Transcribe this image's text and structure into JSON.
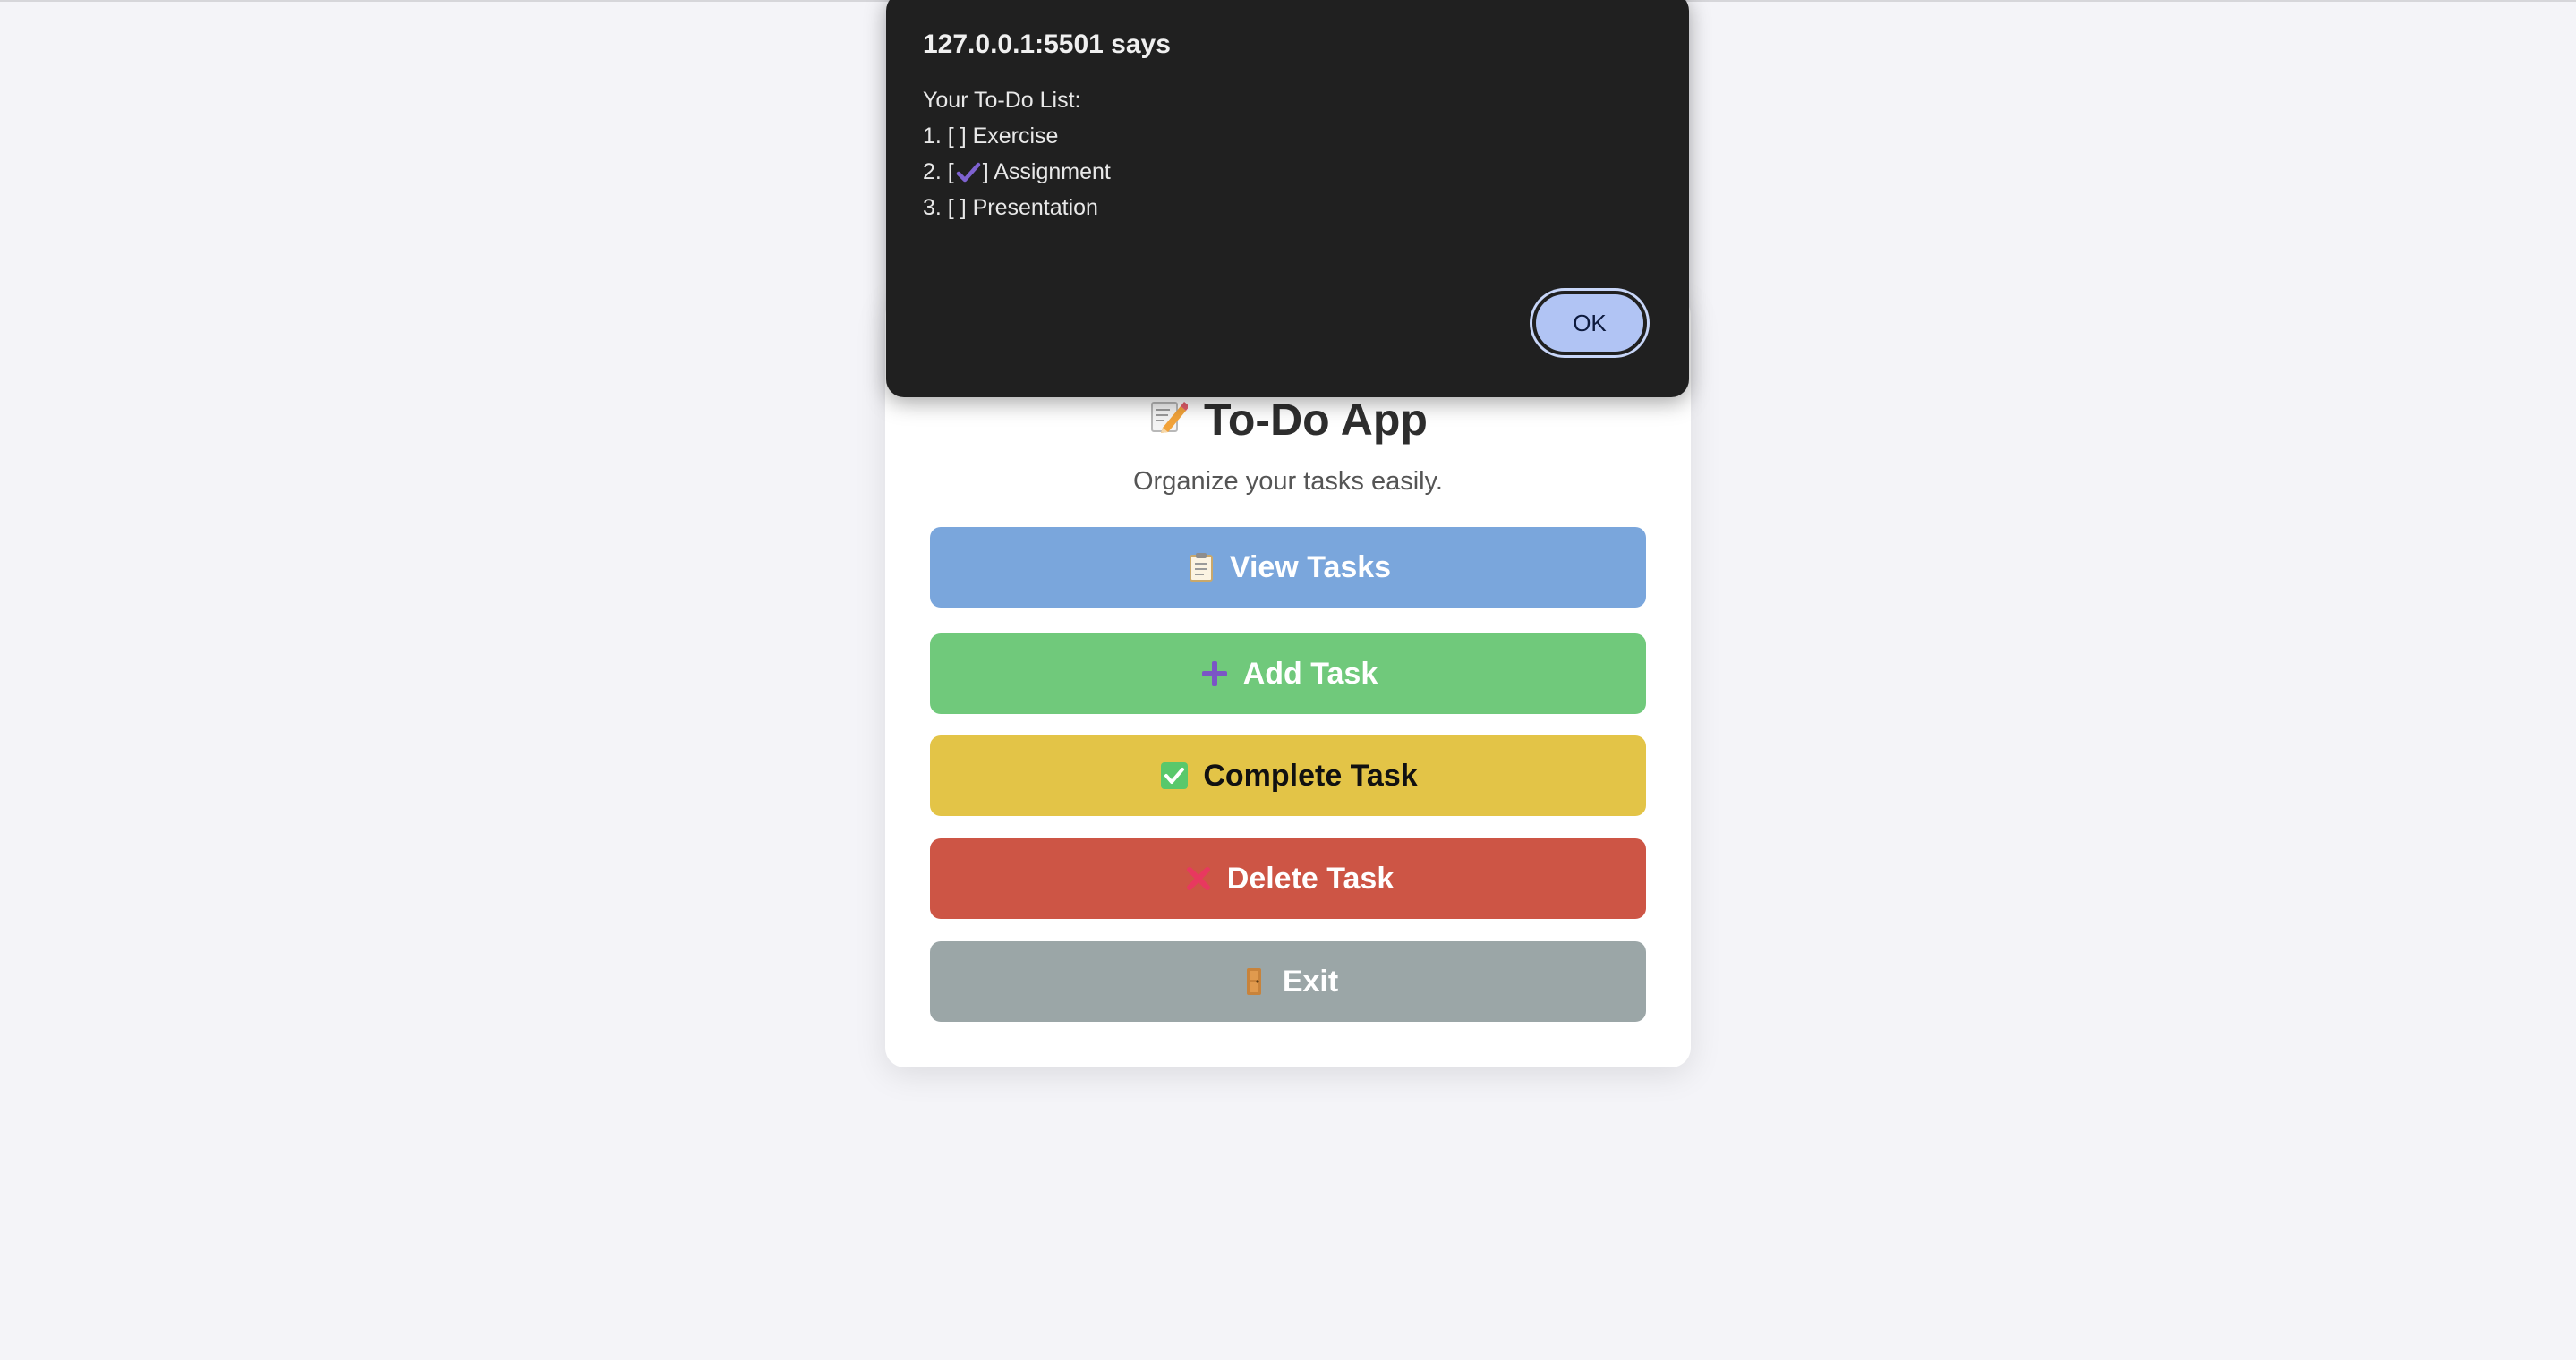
{
  "app": {
    "title": "To-Do App",
    "subtitle": "Organize your tasks easily.",
    "title_icon": "memo-pencil-icon"
  },
  "buttons": {
    "view": {
      "label": "View Tasks",
      "icon": "clipboard-icon",
      "color": "#7aa6dc"
    },
    "add": {
      "label": "Add Task",
      "icon": "plus-icon",
      "color": "#70c97b"
    },
    "complete": {
      "label": "Complete Task",
      "icon": "checkbox-checked-icon",
      "color": "#e3c447"
    },
    "delete": {
      "label": "Delete Task",
      "icon": "cross-icon",
      "color": "#cd5545"
    },
    "exit": {
      "label": "Exit",
      "icon": "door-icon",
      "color": "#9ba6a7"
    }
  },
  "dialog": {
    "title": "127.0.0.1:5501 says",
    "heading": "Your To-Do List:",
    "items": [
      {
        "prefix": "1. [ ",
        "suffix": "] Exercise",
        "done": false
      },
      {
        "prefix": "2. [",
        "suffix": "] Assignment",
        "done": true
      },
      {
        "prefix": "3. [ ",
        "suffix": "] Presentation",
        "done": false
      }
    ],
    "ok_label": "OK"
  }
}
